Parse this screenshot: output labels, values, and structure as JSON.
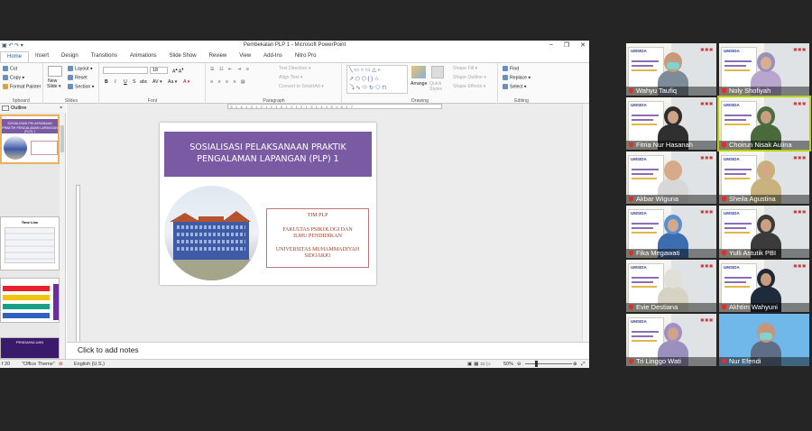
{
  "window": {
    "title": "Pembekalan PLP 1  -  Microsoft PowerPoint",
    "controls": [
      "‒",
      "❐",
      "✕"
    ]
  },
  "tabs": [
    "Home",
    "Insert",
    "Design",
    "Transitions",
    "Animations",
    "Slide Show",
    "Review",
    "View",
    "Add-Ins",
    "Nitro Pro"
  ],
  "ribbon": {
    "clipboard": {
      "cut": "Cut",
      "copy": "Copy ▾",
      "format_painter": "Format Painter",
      "label": "lipboard"
    },
    "slides": {
      "new_slide": "New",
      "new_slide2": "Slide ▾",
      "layout": "Layout ▾",
      "reset": "Reset",
      "section": "Section ▾",
      "label": "Slides"
    },
    "font": {
      "size": "18",
      "bold": "B",
      "italic": "I",
      "underline": "U",
      "strike": "S",
      "shadow": "abc",
      "spacing": "AV ▾",
      "case": "Aa ▾",
      "color": "A ▾",
      "label": "Font"
    },
    "paragraph": {
      "text_direction": "Text Direction ▾",
      "align_text": "Align Text ▾",
      "convert": "Convert to SmartArt ▾",
      "label": "Paragraph"
    },
    "drawing": {
      "arrange": "Arrange",
      "quick_styles": "Quick Styles",
      "shape_fill": "Shape Fill ▾",
      "shape_outline": "Shape Outline ▾",
      "shape_effects": "Shape Effects ▾",
      "label": "Drawing"
    },
    "editing": {
      "find": "Find",
      "replace": "Replace ▾",
      "select": "Select ▾",
      "label": "Editing"
    }
  },
  "left_pane": {
    "tab_slides": "",
    "tab_outline": "Outline",
    "close": "×",
    "thumb1_title": "SOSIALISASI PELAKSANAAN PRAKTIK PENGALAMAN LAPANGAN (PLP) 1",
    "thumb2_title": "Time Line",
    "thumb4_title": "PENDAHULUAN"
  },
  "slide": {
    "title_line1": "SOSIALISASI PELAKSANAAN PRAKTIK",
    "title_line2": "PENGALAMAN LAPANGAN (PLP) 1",
    "team": "TIM PLP",
    "faculty1": "FAKULTAS  PSIKOLOGI DAN",
    "faculty2": "ILMU PENDIDIKAN",
    "univ1": "UNIVERSITAS MUHAMMADIYAH",
    "univ2": "SIDOARJO"
  },
  "notes_placeholder": "Click to add notes",
  "status": {
    "slide": "f 20",
    "theme": "\"Office Theme\"",
    "language": "English (U.S.)",
    "zoom": "50%",
    "zoom_value": 50
  },
  "participants": [
    {
      "name": "Wahyu Taufiq",
      "shirt": "#7d8c99",
      "skin": "#c99a7a",
      "mask": true,
      "hijab": ""
    },
    {
      "name": "Noly Shofiyah",
      "shirt": "#b8a6cf",
      "skin": "#d9b08f",
      "mask": false,
      "hijab": "#9b8fbe"
    },
    {
      "name": "Fitria Nur Hasanah",
      "shirt": "#2f2f2f",
      "skin": "#d0a488",
      "mask": false,
      "hijab": "#2e2e2e"
    },
    {
      "name": "Choirun Nisak Aulina",
      "shirt": "#4a6a3e",
      "skin": "#c99e80",
      "mask": false,
      "hijab": "#4c6d3d"
    },
    {
      "name": "Akbar Wiguna",
      "shirt": "#d7d7d7",
      "skin": "#d7aa8a",
      "mask": false,
      "hijab": ""
    },
    {
      "name": "Sheila Agustina",
      "shirt": "#c9b27d",
      "skin": "#d4a786",
      "mask": false,
      "hijab": "#c8b07b"
    },
    {
      "name": "Fika Megawati",
      "shirt": "#3c6db0",
      "skin": "#d3a98b",
      "mask": false,
      "hijab": "#5a8fd1"
    },
    {
      "name": "Yulli Astutik PBI",
      "shirt": "#3b3b3b",
      "skin": "#caa083",
      "mask": false,
      "hijab": "#3a3a3a"
    },
    {
      "name": "Evie Destiana",
      "shirt": "#d8d2c4",
      "skin": "#e0e0d8",
      "mask": false,
      "hijab": ""
    },
    {
      "name": "Akhtim Wahyuni",
      "shirt": "#1f2a3a",
      "skin": "#c69b7e",
      "mask": false,
      "hijab": "#1f2735"
    },
    {
      "name": "Tri Linggo Wati",
      "shirt": "#9b8fbe",
      "skin": "#d0a488",
      "mask": false,
      "hijab": "#a48fc4"
    },
    {
      "name": "Nur Efendi",
      "shirt": "#5d6e86",
      "skin": "#c6967a",
      "mask": true,
      "hijab": ""
    }
  ],
  "colors": {
    "title_bar": "#7a5aa3",
    "ribbon_file": "#2b579a",
    "speaking_outline": "#b8d000",
    "muted_mic": "#e02d2d"
  }
}
